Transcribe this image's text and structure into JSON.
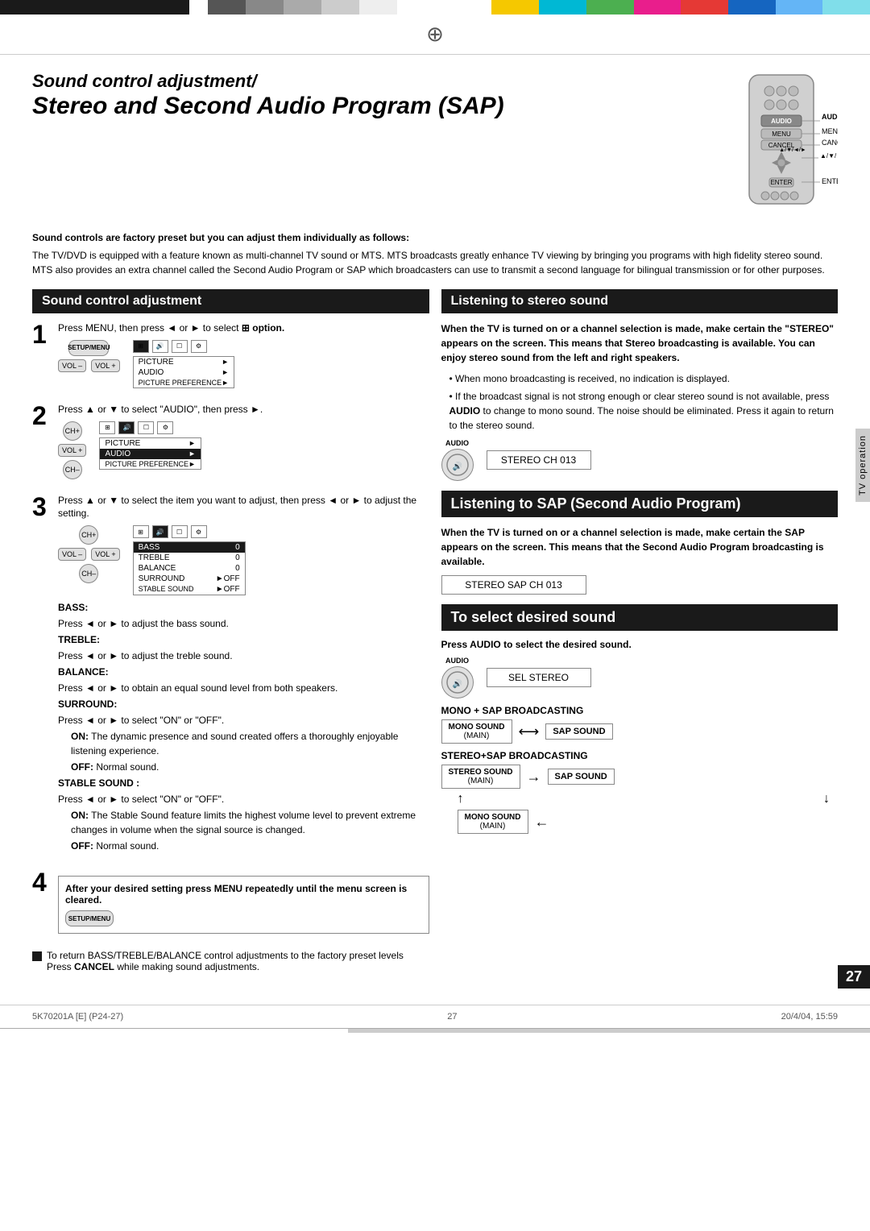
{
  "topbar": {
    "colors": [
      "black",
      "gray1",
      "gray2",
      "gray3",
      "gray4",
      "white",
      "yellow",
      "cyan",
      "green",
      "magenta",
      "red",
      "blue",
      "ltblue",
      "ltcyan"
    ]
  },
  "title": {
    "line1": "Sound control adjustment/",
    "line2": "Stereo and Second Audio Program (SAP)"
  },
  "intro": {
    "bold_line": "Sound controls are factory preset but you can adjust them individually as follows:",
    "para1": "The TV/DVD is equipped with a feature known as multi-channel TV sound or MTS. MTS broadcasts greatly enhance TV viewing by bringing you programs with high fidelity stereo sound.",
    "para2": "MTS also provides an extra channel called the Second Audio Program or SAP which broadcasters can use to transmit a second language for bilingual transmission or for other purposes."
  },
  "left_header": "Sound control adjustment",
  "right_header": "Listening to stereo sound",
  "sap_header": "Listening to SAP (Second Audio Program)",
  "select_sound_header": "To select desired sound",
  "step1": {
    "number": "1",
    "text": "Press MENU, then press ◄ or ► to select",
    "text2": "option."
  },
  "step2": {
    "number": "2",
    "text": "Press ▲ or ▼ to select \"AUDIO\", then press",
    "text2": "►."
  },
  "step3": {
    "number": "3",
    "text": "Press ▲ or ▼ to select the item you want to adjust, then press ◄ or ► to adjust the setting."
  },
  "step4": {
    "number": "4",
    "text": "After your desired setting press MENU repeatedly until the menu screen is cleared."
  },
  "menu1": {
    "title": "SETUP/MENU",
    "items": [
      {
        "label": "PICTURE",
        "arrow": "►"
      },
      {
        "label": "AUDIO",
        "arrow": "►",
        "highlighted": false
      },
      {
        "label": "PICTURE PREFERENCE",
        "arrow": "►"
      }
    ]
  },
  "menu2": {
    "items": [
      {
        "label": "PICTURE",
        "arrow": "►"
      },
      {
        "label": "AUDIO",
        "arrow": "►",
        "highlighted": true
      },
      {
        "label": "PICTURE PREFERENCE",
        "arrow": "►"
      }
    ]
  },
  "bass_menu": {
    "items": [
      {
        "label": "BASS",
        "value": "0",
        "highlighted": true
      },
      {
        "label": "TREBLE",
        "value": "0"
      },
      {
        "label": "BALANCE",
        "value": "0"
      },
      {
        "label": "SURROUND",
        "value": "►OFF"
      },
      {
        "label": "STABLE SOUND",
        "value": "►OFF"
      }
    ]
  },
  "sound_settings": {
    "bass_label": "BASS:",
    "bass_text": "Press ◄ or ► to adjust the bass sound.",
    "treble_label": "TREBLE:",
    "treble_text": "Press ◄ or ► to adjust the treble sound.",
    "balance_label": "BALANCE:",
    "balance_text": "Press ◄ or ► to obtain an equal sound level from both speakers.",
    "surround_label": "SURROUND:",
    "surround_text": "Press ◄ or ► to select \"ON\" or \"OFF\".",
    "surround_on": "ON:",
    "surround_on_text": "The dynamic presence and sound created offers a thoroughly enjoyable listening experience.",
    "surround_off": "OFF:",
    "surround_off_text": "Normal sound.",
    "stable_label": "STABLE SOUND :",
    "stable_text": "Press ◄ or ► to select \"ON\" or \"OFF\".",
    "stable_on": "ON:",
    "stable_on_text": "The Stable Sound feature limits the highest volume level to prevent extreme changes in volume when the signal source is changed.",
    "stable_off": "OFF:",
    "stable_off_text": "Normal sound."
  },
  "bottom_note": {
    "text1": "To return BASS/TREBLE/BALANCE control adjustments to the factory preset levels",
    "text2": "Press CANCEL while making sound adjustments."
  },
  "right_stereo": {
    "para1": "When the TV is turned on or a channel selection is made, make certain the \"STEREO\" appears on the screen. This means that Stereo broadcasting is available. You can enjoy stereo sound from the left and right speakers.",
    "bullet1": "When mono broadcasting is received, no indication is displayed.",
    "bullet2": "If the broadcast signal is not strong enough or clear stereo sound is not available, press AUDIO to change to mono sound. The noise should be eliminated. Press it again to return to the stereo sound.",
    "audio_label": "AUDIO",
    "display_text": "STEREO         CH 013"
  },
  "sap_section": {
    "para1": "When the TV is turned on or a channel selection is made, make certain the SAP appears on the screen. This means that the Second Audio Program broadcasting is available.",
    "display_text": "STEREO  SAP      CH 013"
  },
  "select_sound": {
    "instruction": "Press AUDIO to select the desired sound.",
    "audio_label": "AUDIO",
    "display_text": "SEL STEREO",
    "mono_sap_title": "MONO + SAP BROADCASTING",
    "mono_sound_main": "MONO SOUND\n(MAIN)",
    "sap_sound": "SAP SOUND",
    "stereo_sap_title": "STEREO+SAP BROADCASTING",
    "stereo_sound_main": "STEREO SOUND\n(MAIN)",
    "mono_sound_main2": "MONO SOUND\n(MAIN)"
  },
  "side_label": "TV operation",
  "page_number": "27",
  "footer": {
    "left": "5K70201A [E] (P24-27)",
    "center": "27",
    "right": "20/4/04, 15:59"
  },
  "remote_labels": {
    "audio": "AUDIO",
    "menu": "MENU",
    "cancel": "CANCEL",
    "arrows": "▲/▼/◄/►",
    "enter": "ENTER"
  }
}
